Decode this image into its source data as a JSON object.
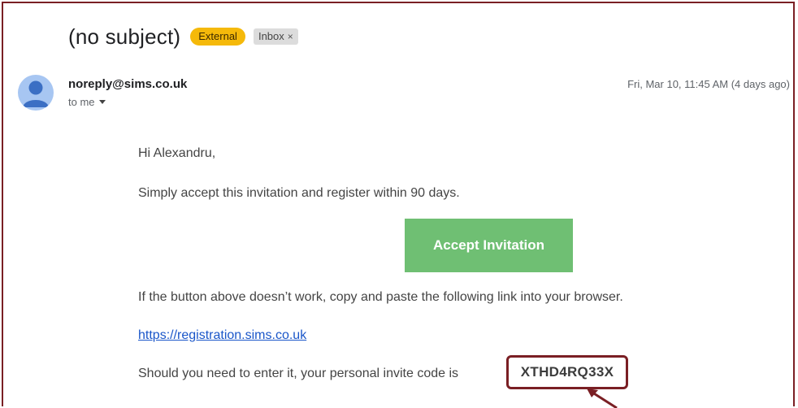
{
  "email": {
    "subject": "(no subject)",
    "labels": {
      "external": "External",
      "inbox": "Inbox",
      "inbox_remove": "×"
    },
    "sender": "noreply@sims.co.uk",
    "recipient": "to me",
    "date": "Fri, Mar 10, 11:45 AM (4 days ago)",
    "body": {
      "greeting": "Hi Alexandru,",
      "line1": "Simply accept this invitation and register within 90 days.",
      "button_label": "Accept Invitation",
      "line2": "If the button above doesn’t work, copy and paste the following link into your browser.",
      "link": "https://registration.sims.co.uk",
      "line3": "Should you need to enter it, your personal invite code is",
      "invite_code": "XTHD4RQ33X"
    }
  },
  "colors": {
    "accent_frame": "#7a1f24",
    "external_badge": "#f5b90a",
    "accept_button": "#6fbf73",
    "link": "#1a56c9",
    "avatar": "#a7c6f2"
  },
  "icons": {
    "avatar": "person-icon",
    "recipient_toggle": "caret-down-icon",
    "annotation": "arrow-icon"
  }
}
